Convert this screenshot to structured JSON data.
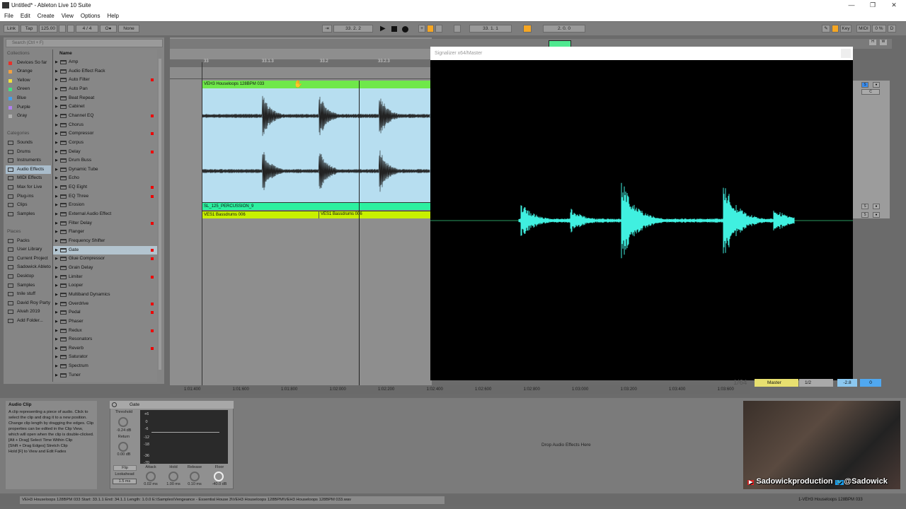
{
  "window": {
    "title": "Untitled* - Ableton Live 10 Suite",
    "minimize": "—",
    "maximize": "❐",
    "close": "✕"
  },
  "menu": [
    "File",
    "Edit",
    "Create",
    "View",
    "Options",
    "Help"
  ],
  "transport": {
    "link": "Link",
    "tap": "Tap",
    "tempo": "125.00",
    "signature": "4 / 4",
    "metronome": "O●",
    "quantize": "None",
    "position": "33.  2.  2",
    "loop_start": "33.  1.  1",
    "loop_length": "2.  0.  0",
    "key": "Key",
    "midi": "MIDI",
    "cpu": "0 %",
    "disk": "D"
  },
  "browser": {
    "search_placeholder": "Search (Ctrl + F)",
    "collections_header": "Collections",
    "collections": [
      {
        "label": "Devices So far",
        "color": "#e8302a"
      },
      {
        "label": "Orange",
        "color": "#f0a040"
      },
      {
        "label": "Yellow",
        "color": "#f0e040"
      },
      {
        "label": "Green",
        "color": "#40e080"
      },
      {
        "label": "Blue",
        "color": "#40a0f0"
      },
      {
        "label": "Purple",
        "color": "#b080f0"
      },
      {
        "label": "Gray",
        "color": "#b0b0b0"
      }
    ],
    "categories_header": "Categories",
    "categories": [
      "Sounds",
      "Drums",
      "Instruments",
      "Audio Effects",
      "MIDI Effects",
      "Max for Live",
      "Plug-ins",
      "Clips",
      "Samples"
    ],
    "selected_category": "Audio Effects",
    "places_header": "Places",
    "places": [
      "Packs",
      "User Library",
      "Current Project",
      "Sadowick Ableton",
      "Desktop",
      "Samples",
      "tnile stuff",
      "David Roy Party",
      "Alvah 2019",
      "Add Folder..."
    ],
    "name_header": "Name",
    "items": [
      {
        "label": "Amp",
        "dot": false
      },
      {
        "label": "Audio Effect Rack",
        "dot": false
      },
      {
        "label": "Auto Filter",
        "dot": true
      },
      {
        "label": "Auto Pan",
        "dot": false
      },
      {
        "label": "Beat Repeat",
        "dot": false
      },
      {
        "label": "Cabinet",
        "dot": false
      },
      {
        "label": "Channel EQ",
        "dot": true
      },
      {
        "label": "Chorus",
        "dot": false
      },
      {
        "label": "Compressor",
        "dot": true
      },
      {
        "label": "Corpus",
        "dot": false
      },
      {
        "label": "Delay",
        "dot": true
      },
      {
        "label": "Drum Buss",
        "dot": false
      },
      {
        "label": "Dynamic Tube",
        "dot": false
      },
      {
        "label": "Echo",
        "dot": false
      },
      {
        "label": "EQ Eight",
        "dot": true
      },
      {
        "label": "EQ Three",
        "dot": true
      },
      {
        "label": "Erosion",
        "dot": false
      },
      {
        "label": "External Audio Effect",
        "dot": false
      },
      {
        "label": "Filter Delay",
        "dot": true
      },
      {
        "label": "Flanger",
        "dot": false
      },
      {
        "label": "Frequency Shifter",
        "dot": false
      },
      {
        "label": "Gate",
        "dot": true
      },
      {
        "label": "Glue Compressor",
        "dot": true
      },
      {
        "label": "Grain Delay",
        "dot": false
      },
      {
        "label": "Limiter",
        "dot": true
      },
      {
        "label": "Looper",
        "dot": false
      },
      {
        "label": "Multiband Dynamics",
        "dot": false
      },
      {
        "label": "Overdrive",
        "dot": true
      },
      {
        "label": "Pedal",
        "dot": true
      },
      {
        "label": "Phaser",
        "dot": false
      },
      {
        "label": "Redux",
        "dot": true
      },
      {
        "label": "Resonators",
        "dot": false
      },
      {
        "label": "Reverb",
        "dot": true
      },
      {
        "label": "Saturator",
        "dot": false
      },
      {
        "label": "Spectrum",
        "dot": false
      },
      {
        "label": "Tuner",
        "dot": false
      }
    ],
    "selected_item": "Gate"
  },
  "arrangement": {
    "ruler": [
      "33",
      "33.1.3",
      "33.2",
      "33.2.3"
    ],
    "clips": {
      "track1": "VEH3 Houseloops 128BPM 033",
      "track2": "SL_125_PERCUSSION_9",
      "track3a": "VES1 Bassdrums 006",
      "track3b": "VES1 Bassdrums 006"
    },
    "time_ruler": [
      "1:01:400",
      "1:01:600",
      "1:01:800",
      "1:02:000",
      "1:02:200",
      "1:02:400",
      "1:02:600",
      "1:02:800",
      "1:03:000",
      "1:03:200",
      "1:03:400",
      "1:03:600"
    ],
    "grid": "1/64",
    "clip_color": "#6fe84a"
  },
  "plugin": {
    "title": "Signalizer x64/Master",
    "wave_color": "#40f0e0"
  },
  "mixer": {
    "solo": "S",
    "record": "●",
    "crossfade": "C",
    "master": "Master",
    "routing": "1/2",
    "volume": "-2.8",
    "pan": "0",
    "h": "H",
    "w": "W"
  },
  "info": {
    "title": "Audio Clip",
    "lines": [
      "A clip representing a piece of audio. Click to select the clip and drag it to a new position. Change clip length by dragging the edges. Clip properties can be edited in the Clip View, which will open when the clip is double-clicked.",
      "[Alt + Drag] Select Time Within Clip",
      "[Shift + Drag Edges] Stretch Clip",
      "Hold [F] to View and Edit Fades"
    ]
  },
  "gate": {
    "title": "Gate",
    "threshold_label": "Threshold",
    "threshold": "-9.24 dB",
    "return_label": "Return",
    "return": "0.00 dB",
    "flip": "Flip",
    "lookahead_label": "Lookahead",
    "lookahead": "1.5 ms",
    "attack_label": "Attack",
    "attack": "0.02 ms",
    "hold_label": "Hold",
    "hold": "1.00 ms",
    "release_label": "Release",
    "release": "0.10 ms",
    "floor_label": "Floor",
    "floor": "-40.0 dB",
    "scale": [
      "+6",
      "0",
      "-6",
      "-12",
      "-18",
      "-36",
      "-70"
    ]
  },
  "drop_text": "Drop Audio Effects Here",
  "webcam": {
    "youtube": "Sadowickproduction",
    "twitter": "@Sadowick"
  },
  "status": {
    "text": "VEH3 Houseloops 128BPM 033  Start: 33.1.1  End: 34.1.1  Length: 1.0.0  E:\\Samples\\Vengeance - Essential House 3\\VEH3 Houseloops 128BPM\\VEH3 Houseloops 128BPM 033.wav",
    "track": "1-VEH3 Houseloops 128BPM 033"
  }
}
